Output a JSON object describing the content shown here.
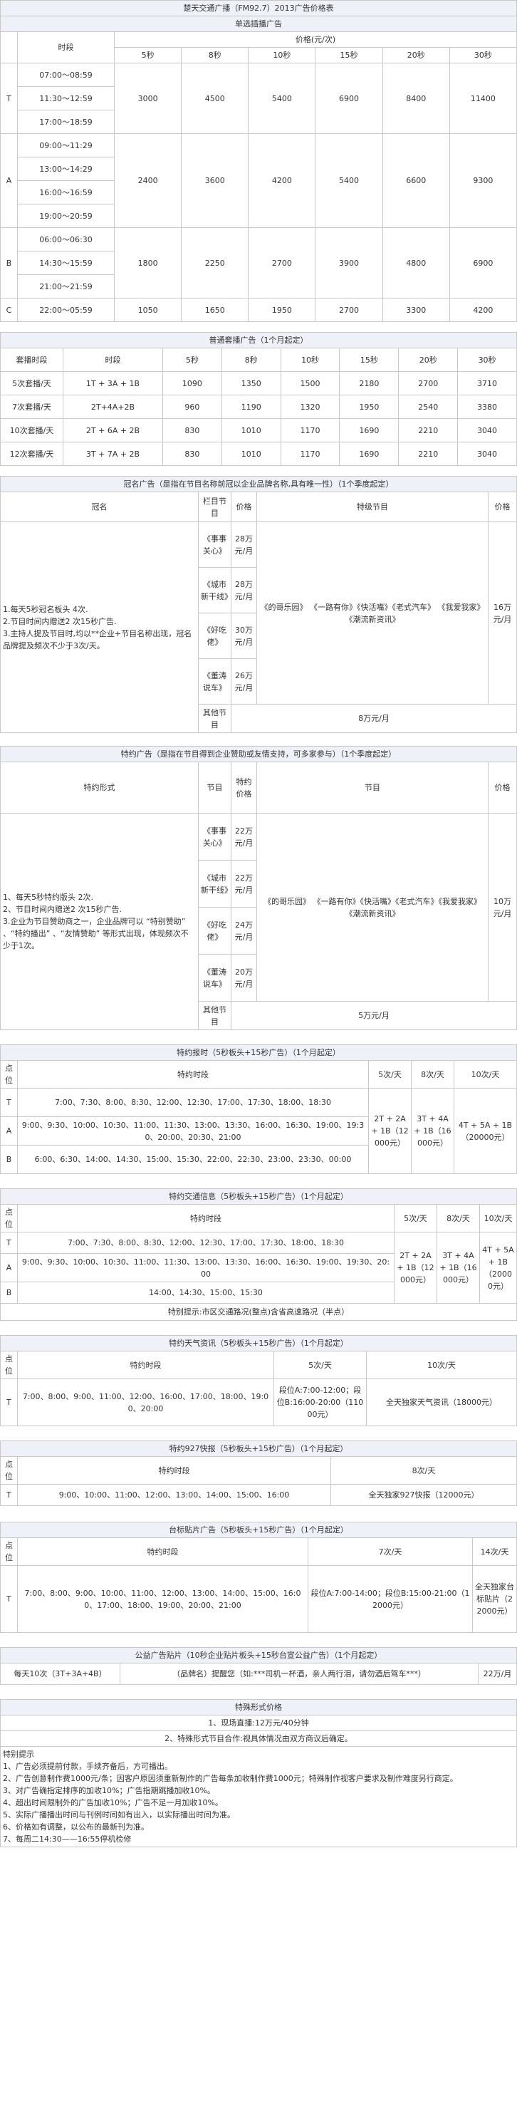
{
  "s1": {
    "title": "楚天交通广播（FM92.7）2013广告价格表",
    "subtitle": "单选插播广告",
    "col_slot": "时段",
    "col_price": "价格(元/次)",
    "durations": [
      "5秒",
      "8秒",
      "10秒",
      "15秒",
      "20秒",
      "30秒"
    ],
    "groups": [
      {
        "grade": "T",
        "times": [
          "07:00～08:59",
          "11:30～12:59",
          "17:00～18:59"
        ],
        "prices": [
          "3000",
          "4500",
          "5400",
          "6900",
          "8400",
          "11400"
        ]
      },
      {
        "grade": "A",
        "times": [
          "09:00～11:29",
          "13:00～14:29",
          "16:00～16:59",
          "19:00～20:59"
        ],
        "prices": [
          "2400",
          "3600",
          "4200",
          "5400",
          "6600",
          "9300"
        ]
      },
      {
        "grade": "B",
        "times": [
          "06:00～06:30",
          "14:30～15:59",
          "21:00～21:59"
        ],
        "prices": [
          "1800",
          "2250",
          "2700",
          "3900",
          "4800",
          "6900"
        ]
      },
      {
        "grade": "C",
        "times": [
          "22:00～05:59"
        ],
        "prices": [
          "1050",
          "1650",
          "1950",
          "2700",
          "3300",
          "4200"
        ]
      }
    ]
  },
  "s2": {
    "title": "普通套播广告（1个月起定）",
    "headers": [
      "套播时段",
      "时段",
      "5秒",
      "8秒",
      "10秒",
      "15秒",
      "20秒",
      "30秒"
    ],
    "rows": [
      [
        "5次套播/天",
        "1T + 3A + 1B",
        "1090",
        "1350",
        "1500",
        "2180",
        "2700",
        "3710"
      ],
      [
        "7次套播/天",
        "2T+4A+2B",
        "960",
        "1190",
        "1320",
        "1950",
        "2540",
        "3380"
      ],
      [
        "10次套播/天",
        "2T + 6A + 2B",
        "830",
        "1010",
        "1170",
        "1690",
        "2210",
        "3040"
      ],
      [
        "12次套播/天",
        "3T + 7A + 2B",
        "830",
        "1010",
        "1170",
        "1690",
        "2210",
        "3040"
      ]
    ]
  },
  "s3": {
    "title": "冠名广告（是指在节目名称前冠以企业品牌名称,具有唯一性）（1个季度起定）",
    "col_name": "冠名",
    "col_program": "栏目节目",
    "col_price": "价格",
    "col_special": "特级节目",
    "col_price2": "价格",
    "desc": "1.每天5秒冠名板头 4次.\n2.节目时间内赠送2 次15秒广告.\n3.主持人提及节目时,均以**企业+节目名称出现，冠名品牌提及频次不少于3次/天。",
    "programs": [
      {
        "name": "《事事关心》",
        "price": "28万元/月"
      },
      {
        "name": "《城市新干线》",
        "price": "28万元/月"
      },
      {
        "name": "《好吃佬》",
        "price": "30万元/月"
      },
      {
        "name": "《董涛说车》",
        "price": "26万元/月"
      }
    ],
    "special_programs": "《的哥乐园》 《一路有你》《快活嘴》《老式汽车》 《我爱我家》《潮流新资讯》",
    "special_price": "16万元/月",
    "other_label": "其他节目",
    "other_price": "8万元/月"
  },
  "s4": {
    "title": "特约广告（是指在节目得到企业赞助或友情支持，可多家参与）（1个季度起定）",
    "col_form": "特约形式",
    "col_program": "节目",
    "col_price": "特约价格",
    "col_special": "节目",
    "col_price2": "价格",
    "desc": "1、每天5秒特约版头 2次.\n2、节目时间内赠送2 次15秒广告.\n3.企业为节目赞助商之一，企业品牌可以 “特别赞助” 、“特约播出” 、“友情赞助” 等形式出现，体现频次不少于1次。",
    "programs": [
      {
        "name": "《事事关心》",
        "price": "22万元/月"
      },
      {
        "name": "《城市新干线》",
        "price": "22万元/月"
      },
      {
        "name": "《好吃佬》",
        "price": "24万元/月"
      },
      {
        "name": "《董涛说车》",
        "price": "20万元/月"
      }
    ],
    "special_programs": "《的哥乐园》 《一路有你》《快活嘴》《老式汽车》《我爱我家》《潮流新资讯》",
    "special_price": "10万元/月",
    "other_label": "其他节目",
    "other_price": "5万元/月"
  },
  "s5": {
    "title": "特约报时（5秒板头+15秒广告）（1个月起定）",
    "col_point": "点位",
    "col_time": "特约时段",
    "cols": [
      "5次/天",
      "8次/天",
      "10次/天"
    ],
    "rows": [
      {
        "grade": "T",
        "times": "7:00、7:30、8:00、8:30、12:00、12:30、17:00、17:30、18:00、18:30"
      },
      {
        "grade": "A",
        "times": "9:00、9:30、10:00、10:30、11:00、11:30、13:00、13:30、16:00、16:30、19:00、19:30、20:00、20:30、21:00"
      },
      {
        "grade": "B",
        "times": "6:00、6:30、14:00、14:30、15:00、15:30、22:00、22:30、23:00、23:30、00:00"
      }
    ],
    "prices": [
      "2T + 2A + 1B（12000元）",
      "3T + 4A + 1B（16000元）",
      "4T + 5A + 1B（20000元）"
    ]
  },
  "s6": {
    "title": "特约交通信息（5秒板头+15秒广告）（1个月起定）",
    "col_point": "点位",
    "col_time": "特约时段",
    "cols": [
      "5次/天",
      "8次/天",
      "10次/天"
    ],
    "rows": [
      {
        "grade": "T",
        "times": "7:00、7:30、8:00、8:30、12:00、12:30、17:00、17:30、18:00、18:30"
      },
      {
        "grade": "A",
        "times": "9:00、9:30、10:00、10:30、11:00、11:30、13:00、13:30、16:00、16:30、19:00、19:30、20:00"
      },
      {
        "grade": "B",
        "times": "14:00、14:30、15:00、15:30"
      }
    ],
    "prices": [
      "2T + 2A + 1B（12000元）",
      "3T + 4A + 1B（16000元）",
      "4T + 5A + 1B（20000元）"
    ],
    "note": "特别提示:市区交通路况(整点)含省高速路况（半点）"
  },
  "s7": {
    "title": "特约天气资讯（5秒板头+15秒广告）（1个月起定）",
    "col_point": "点位",
    "col_time": "特约时段",
    "cols": [
      "5次/天",
      "10次/天"
    ],
    "grade": "T",
    "times": "7:00、8:00、9:00、11:00、12:00、16:00、17:00、18:00、19:00、20:00",
    "price1": "段位A:7:00-12:00；段位B:16:00-20:00（11000元）",
    "price2": "全天独家天气资讯（18000元）"
  },
  "s8": {
    "title": "特约927快报（5秒板头+15秒广告）（1个月起定）",
    "col_point": "点位",
    "col_time": "特约时段",
    "col_price": "8次/天",
    "grade": "T",
    "times": "9:00、10:00、11:00、12:00、13:00、14:00、15:00、16:00",
    "price": "全天独家927快报（12000元）"
  },
  "s9": {
    "title": "台标贴片广告（5秒板头+15秒广告）（1个月起定）",
    "col_point": "点位",
    "col_time": "特约时段",
    "cols": [
      "7次/天",
      "14次/天"
    ],
    "grade": "T",
    "times": "7:00、8:00、9:00、10:00、11:00、12:00、13:00、14:00、15:00、16:00、17:00、18:00、19:00、20:00、21:00",
    "price1": "段位A:7:00-14:00；段位B:15:00-21:00（12000元）",
    "price2": "全天独家台标贴片（22000元）"
  },
  "s10": {
    "title": "公益广告贴片（10秒企业贴片板头+15秒台宣公益广告）（1个月起定）",
    "freq": "每天10次（3T+3A+4B）",
    "content": "（品牌名）提醒您（如:***司机一杯酒，亲人两行泪，请勿酒后驾车***）",
    "price": "22万/月"
  },
  "s11": {
    "title": "特殊形式价格",
    "line1": "1、现场直播:12万元/40分钟",
    "line2": "2、特殊形式节目合作:视具体情况由双方商议后确定。",
    "notes_title": "特别提示",
    "notes": [
      "1、广告必须提前付款，手续齐备后，方可播出。",
      "2、广告创意制作费1000元/条；因客户原因须重新制作的广告每条加收制作费1000元；特殊制作视客户要求及制作难度另行商定。",
      "3、对广告确指定排序的加收10%；广告指期跳播加收10%。",
      "4、超出时间限制外的广告加收10%；广告不足一月加收10%。",
      "5、实际广播播出时间与刊例时间如有出入，以实际播出时间为准。",
      "6、价格如有调整，以公布的最新刊为准。",
      "7、每周二14:30——16:55停机检修"
    ]
  }
}
